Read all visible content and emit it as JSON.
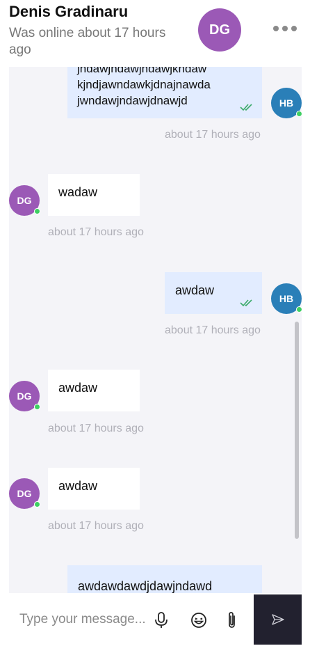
{
  "header": {
    "contact_name": "Denis Gradinaru",
    "status": "Was online about 17 hours ago",
    "avatar_initials": "DG",
    "more_icon": "more-horizontal-icon"
  },
  "users": {
    "contact_initials": "DG",
    "me_initials": "HB",
    "contact_color": "#9b59b6",
    "me_color": "#2a7fb8",
    "online_color": "#3ecf62"
  },
  "messages": [
    {
      "direction": "outgoing",
      "text": "jndawjndawjndawjkndaw kjndjawndawkjdnajnawda jwndawjndawjdnawjd",
      "time": "about 17 hours ago",
      "read": true
    },
    {
      "direction": "incoming",
      "text": "wadaw",
      "time": "about 17 hours ago"
    },
    {
      "direction": "outgoing",
      "text": "awdaw",
      "time": "about 17 hours ago",
      "read": true
    },
    {
      "direction": "incoming",
      "text": "awdaw",
      "time": "about 17 hours ago"
    },
    {
      "direction": "incoming",
      "text": "awdaw",
      "time": "about 17 hours ago"
    },
    {
      "direction": "outgoing",
      "text": "awdawdawdjdawjndawd",
      "time": ""
    }
  ],
  "composer": {
    "placeholder": "Type your message...",
    "value": "",
    "icons": [
      "microphone-icon",
      "emoji-icon",
      "paperclip-icon",
      "send-icon"
    ]
  },
  "colors": {
    "outgoing_bubble": "#e2ecff",
    "incoming_bubble": "#ffffff",
    "chat_background": "#f4f4f8",
    "send_button": "#22212f",
    "read_check": "#3aaa6a"
  }
}
